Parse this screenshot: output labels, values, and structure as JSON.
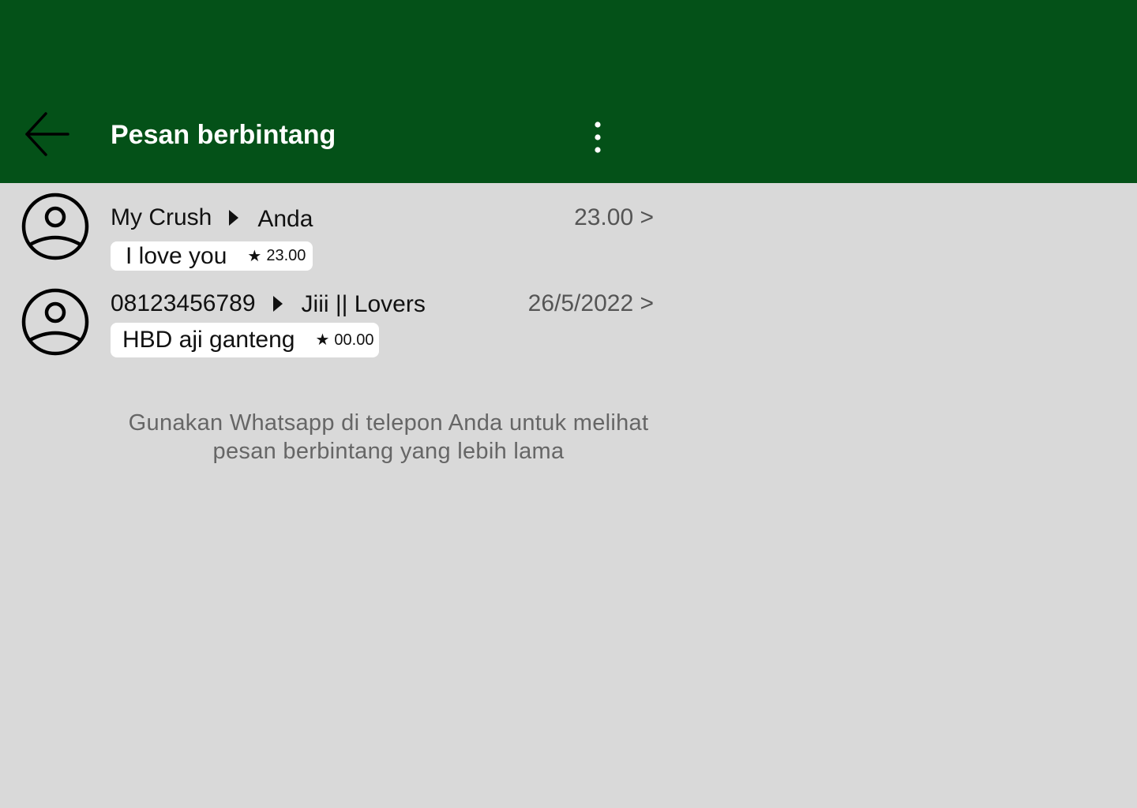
{
  "header": {
    "title": "Pesan berbintang",
    "back_icon": "arrow-left-icon",
    "menu_icon": "more-vert-icon",
    "background": "#045118"
  },
  "messages": [
    {
      "from": "My Crush",
      "to": "Anda",
      "time_link": "23.00 >",
      "text": "I love you",
      "star": "★",
      "star_time": "23.00"
    },
    {
      "from": "08123456789",
      "to": "Jiii || Lovers",
      "time_link": "26/5/2022 >",
      "text": "HBD aji ganteng",
      "star": "★",
      "star_time": "00.00"
    }
  ],
  "footer": {
    "line1": "Gunakan Whatsapp di telepon Anda untuk melihat",
    "line2": "pesan berbintang yang lebih lama"
  }
}
